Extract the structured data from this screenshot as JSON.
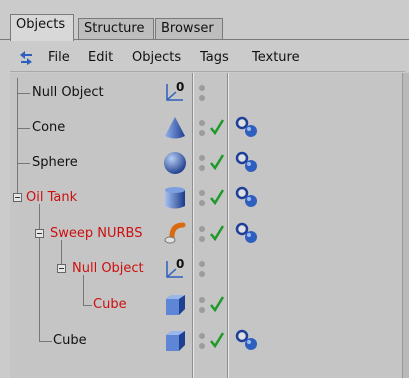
{
  "tabs": [
    {
      "label": "Objects",
      "active": true
    },
    {
      "label": "Structure",
      "active": false
    },
    {
      "label": "Browser",
      "active": false
    }
  ],
  "menu": {
    "items": [
      "File",
      "Edit",
      "Objects",
      "Tags",
      "Texture"
    ]
  },
  "objects": [
    {
      "name": "Null Object",
      "icon": "null-object-icon",
      "color": "#111111",
      "has_tags": false,
      "expanded": null
    },
    {
      "name": "Cone",
      "icon": "cone-icon",
      "color": "#111111",
      "has_tags": true,
      "expanded": null
    },
    {
      "name": "Sphere",
      "icon": "sphere-icon",
      "color": "#111111",
      "has_tags": true,
      "expanded": null
    },
    {
      "name": "Oil Tank",
      "icon": "cylinder-icon",
      "color": "#cc1010",
      "has_tags": true,
      "expanded": true
    },
    {
      "name": "Sweep NURBS",
      "icon": "sweep-nurbs-icon",
      "color": "#cc1010",
      "has_tags": true,
      "expanded": true
    },
    {
      "name": "Null Object",
      "icon": "null-object-icon",
      "color": "#cc1010",
      "has_tags": false,
      "expanded": true
    },
    {
      "name": "Cube",
      "icon": "cube-icon",
      "color": "#cc1010",
      "has_tags": false,
      "expanded": null
    },
    {
      "name": "Cube",
      "icon": "cube-icon",
      "color": "#111111",
      "has_tags": true,
      "expanded": null
    }
  ],
  "colors": {
    "selected_red": "#cc1010",
    "check_green": "#1f9a2a",
    "icon_blue": "#2e5fbf"
  }
}
